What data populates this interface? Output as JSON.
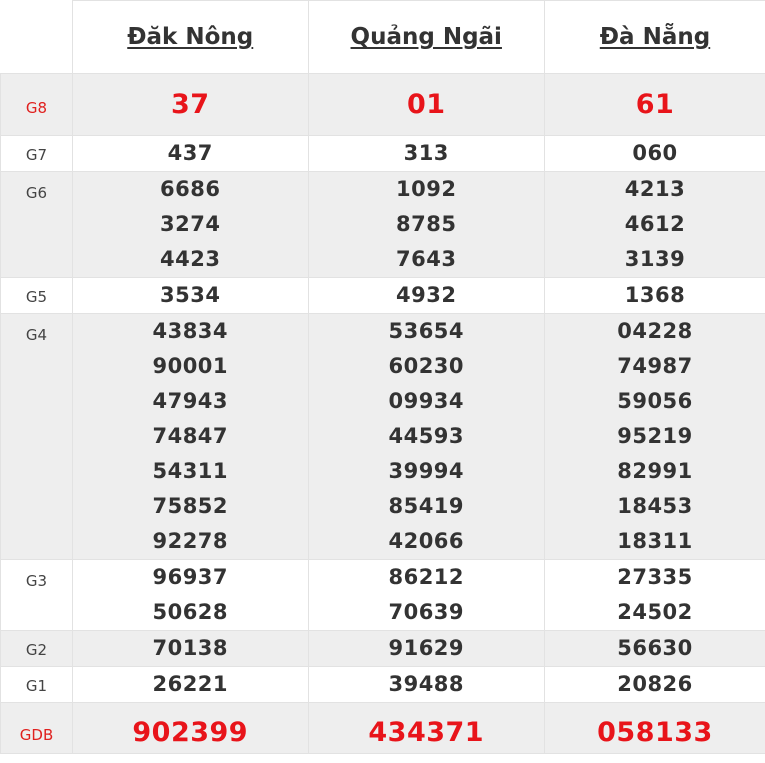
{
  "provinces": [
    "Đăk Nông",
    "Quảng Ngãi",
    "Đà Nẵng"
  ],
  "prizes": [
    {
      "label": "G8",
      "highlight": true,
      "shade": true,
      "values": [
        [
          "37"
        ],
        [
          "01"
        ],
        [
          "61"
        ]
      ]
    },
    {
      "label": "G7",
      "highlight": false,
      "shade": false,
      "values": [
        [
          "437"
        ],
        [
          "313"
        ],
        [
          "060"
        ]
      ]
    },
    {
      "label": "G6",
      "highlight": false,
      "shade": true,
      "values": [
        [
          "6686",
          "3274",
          "4423"
        ],
        [
          "1092",
          "8785",
          "7643"
        ],
        [
          "4213",
          "4612",
          "3139"
        ]
      ]
    },
    {
      "label": "G5",
      "highlight": false,
      "shade": false,
      "values": [
        [
          "3534"
        ],
        [
          "4932"
        ],
        [
          "1368"
        ]
      ]
    },
    {
      "label": "G4",
      "highlight": false,
      "shade": true,
      "values": [
        [
          "43834",
          "90001",
          "47943",
          "74847",
          "54311",
          "75852",
          "92278"
        ],
        [
          "53654",
          "60230",
          "09934",
          "44593",
          "39994",
          "85419",
          "42066"
        ],
        [
          "04228",
          "74987",
          "59056",
          "95219",
          "82991",
          "18453",
          "18311"
        ]
      ]
    },
    {
      "label": "G3",
      "highlight": false,
      "shade": false,
      "values": [
        [
          "96937",
          "50628"
        ],
        [
          "86212",
          "70639"
        ],
        [
          "27335",
          "24502"
        ]
      ]
    },
    {
      "label": "G2",
      "highlight": false,
      "shade": true,
      "values": [
        [
          "70138"
        ],
        [
          "91629"
        ],
        [
          "56630"
        ]
      ]
    },
    {
      "label": "G1",
      "highlight": false,
      "shade": false,
      "values": [
        [
          "26221"
        ],
        [
          "39488"
        ],
        [
          "20826"
        ]
      ]
    },
    {
      "label": "GDB",
      "highlight": true,
      "shade": true,
      "values": [
        [
          "902399"
        ],
        [
          "434371"
        ],
        [
          "058133"
        ]
      ]
    }
  ],
  "colors": {
    "highlight": "#e8141a",
    "label_highlight": "#e0201e",
    "shade": "#eeeeee",
    "text": "#333333"
  }
}
